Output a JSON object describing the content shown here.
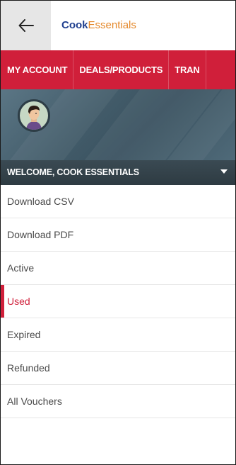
{
  "header": {
    "back_icon": "arrow-left-icon",
    "logo": {
      "part1": "Cook",
      "part2": "Essentials"
    },
    "colors": {
      "brand_blue": "#1f3f8f",
      "brand_orange": "#e4882a"
    }
  },
  "nav": {
    "items": [
      "MY ACCOUNT",
      "DEALS/PRODUCTS",
      "TRAN"
    ],
    "color": "#d01f3a"
  },
  "profile": {
    "avatar_icon": "user-avatar-icon",
    "welcome": "WELCOME, COOK ESSENTIALS",
    "dropdown_icon": "caret-down-icon"
  },
  "menu": {
    "items": [
      {
        "label": "Download CSV"
      },
      {
        "label": "Download PDF"
      },
      {
        "label": "Active"
      },
      {
        "label": "Used",
        "active": true
      },
      {
        "label": "Expired"
      },
      {
        "label": "Refunded"
      },
      {
        "label": "All Vouchers"
      }
    ],
    "active_color": "#d01f3a"
  }
}
